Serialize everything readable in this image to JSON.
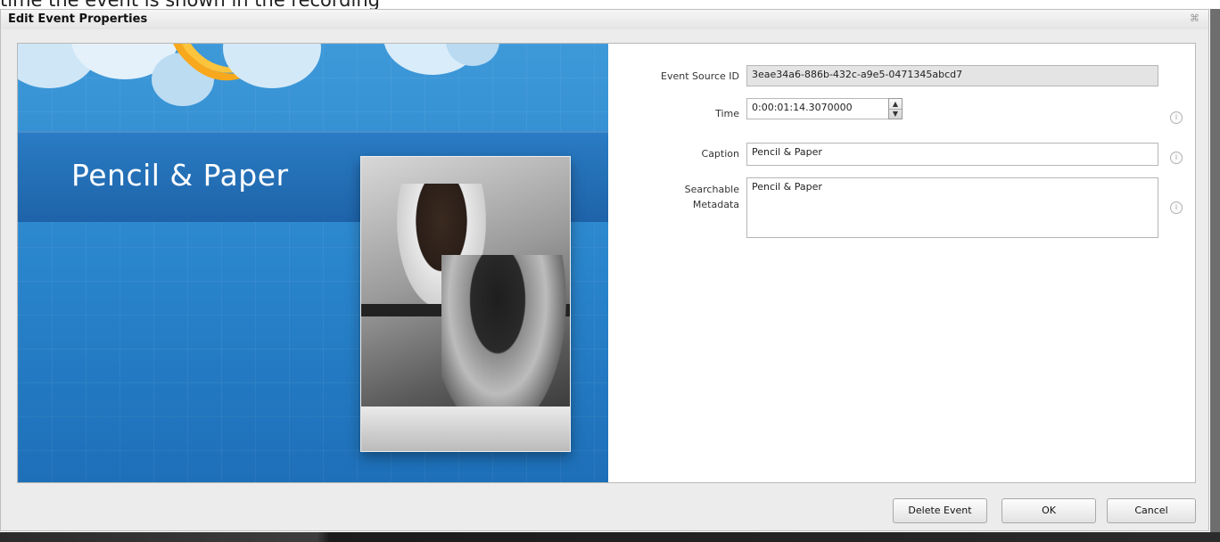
{
  "background_caption": "time the event is shown in the recording",
  "dialog": {
    "title": "Edit Event Properties",
    "close_glyph": "⌘"
  },
  "slide": {
    "title": "Pencil & Paper"
  },
  "form": {
    "event_source_id_label": "Event Source ID",
    "event_source_id_value": "3eae34a6-886b-432c-a9e5-0471345abcd7",
    "time_label": "Time",
    "time_value": "0:00:01:14.3070000",
    "caption_label": "Caption",
    "caption_value": "Pencil & Paper",
    "metadata_label_line1": "Searchable",
    "metadata_label_line2": "Metadata",
    "metadata_value": "Pencil & Paper",
    "info_glyph": "i"
  },
  "buttons": {
    "delete": "Delete Event",
    "ok": "OK",
    "cancel": "Cancel"
  },
  "icons": [
    "close-icon",
    "spinner-up-icon",
    "spinner-down-icon",
    "info-icon"
  ]
}
